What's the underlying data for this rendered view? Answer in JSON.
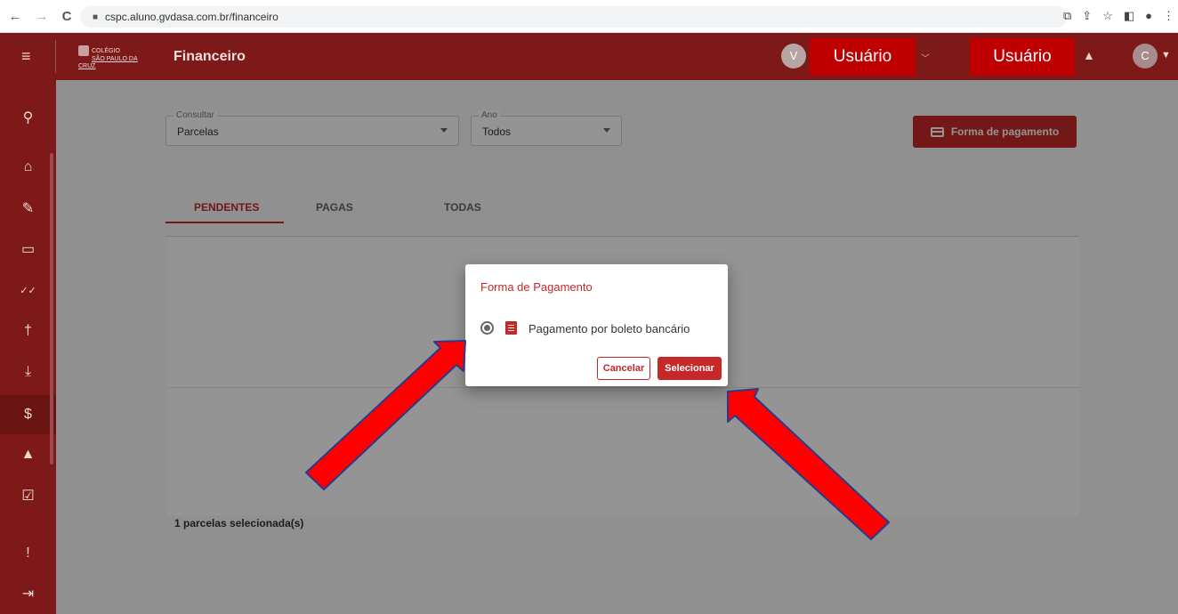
{
  "browser": {
    "url": "cspc.aluno.gvdasa.com.br/financeiro",
    "back": "←",
    "forward": "→",
    "reload": "C"
  },
  "header": {
    "logo_small": "COLÉGIO",
    "logo_name": "SÃO PAULO DA CRUZ",
    "title": "Financeiro",
    "avatar_left": "V",
    "user_label_1": "Usuário",
    "user_label_2": "Usuário",
    "avatar_right": "C"
  },
  "sidebar": {
    "items": [
      {
        "icon": "search-icon",
        "glyph": "⚲"
      },
      {
        "icon": "home-icon",
        "glyph": "⌂"
      },
      {
        "icon": "pencil-icon",
        "glyph": "✎"
      },
      {
        "icon": "calendar-icon",
        "glyph": "▭"
      },
      {
        "icon": "double-check-icon",
        "glyph": "✓✓"
      },
      {
        "icon": "accessibility-icon",
        "glyph": "†"
      },
      {
        "icon": "download-icon",
        "glyph": "⤓"
      },
      {
        "icon": "dollar-icon",
        "glyph": "$"
      },
      {
        "icon": "bell-icon",
        "glyph": "▲"
      },
      {
        "icon": "clipboard-check-icon",
        "glyph": "☑"
      },
      {
        "icon": "feedback-icon",
        "glyph": "!"
      },
      {
        "icon": "logout-icon",
        "glyph": "⇥"
      }
    ],
    "active_index": 7
  },
  "filters": {
    "consultar_label": "Consultar",
    "consultar_value": "Parcelas",
    "ano_label": "Ano",
    "ano_value": "Todos"
  },
  "actions": {
    "payment_button": "Forma de pagamento"
  },
  "tabs": [
    "PENDENTES",
    "PAGAS",
    "TODAS"
  ],
  "active_tab": 0,
  "footer": {
    "selected_text": "1 parcelas selecionada(s)"
  },
  "dialog": {
    "title": "Forma de Pagamento",
    "option_label": "Pagamento por boleto bancário",
    "option_selected": true,
    "cancel_label": "Cancelar",
    "select_label": "Selecionar"
  },
  "colors": {
    "brand": "#7d1919",
    "accent": "#c62828",
    "annotation": "#ff0000"
  }
}
